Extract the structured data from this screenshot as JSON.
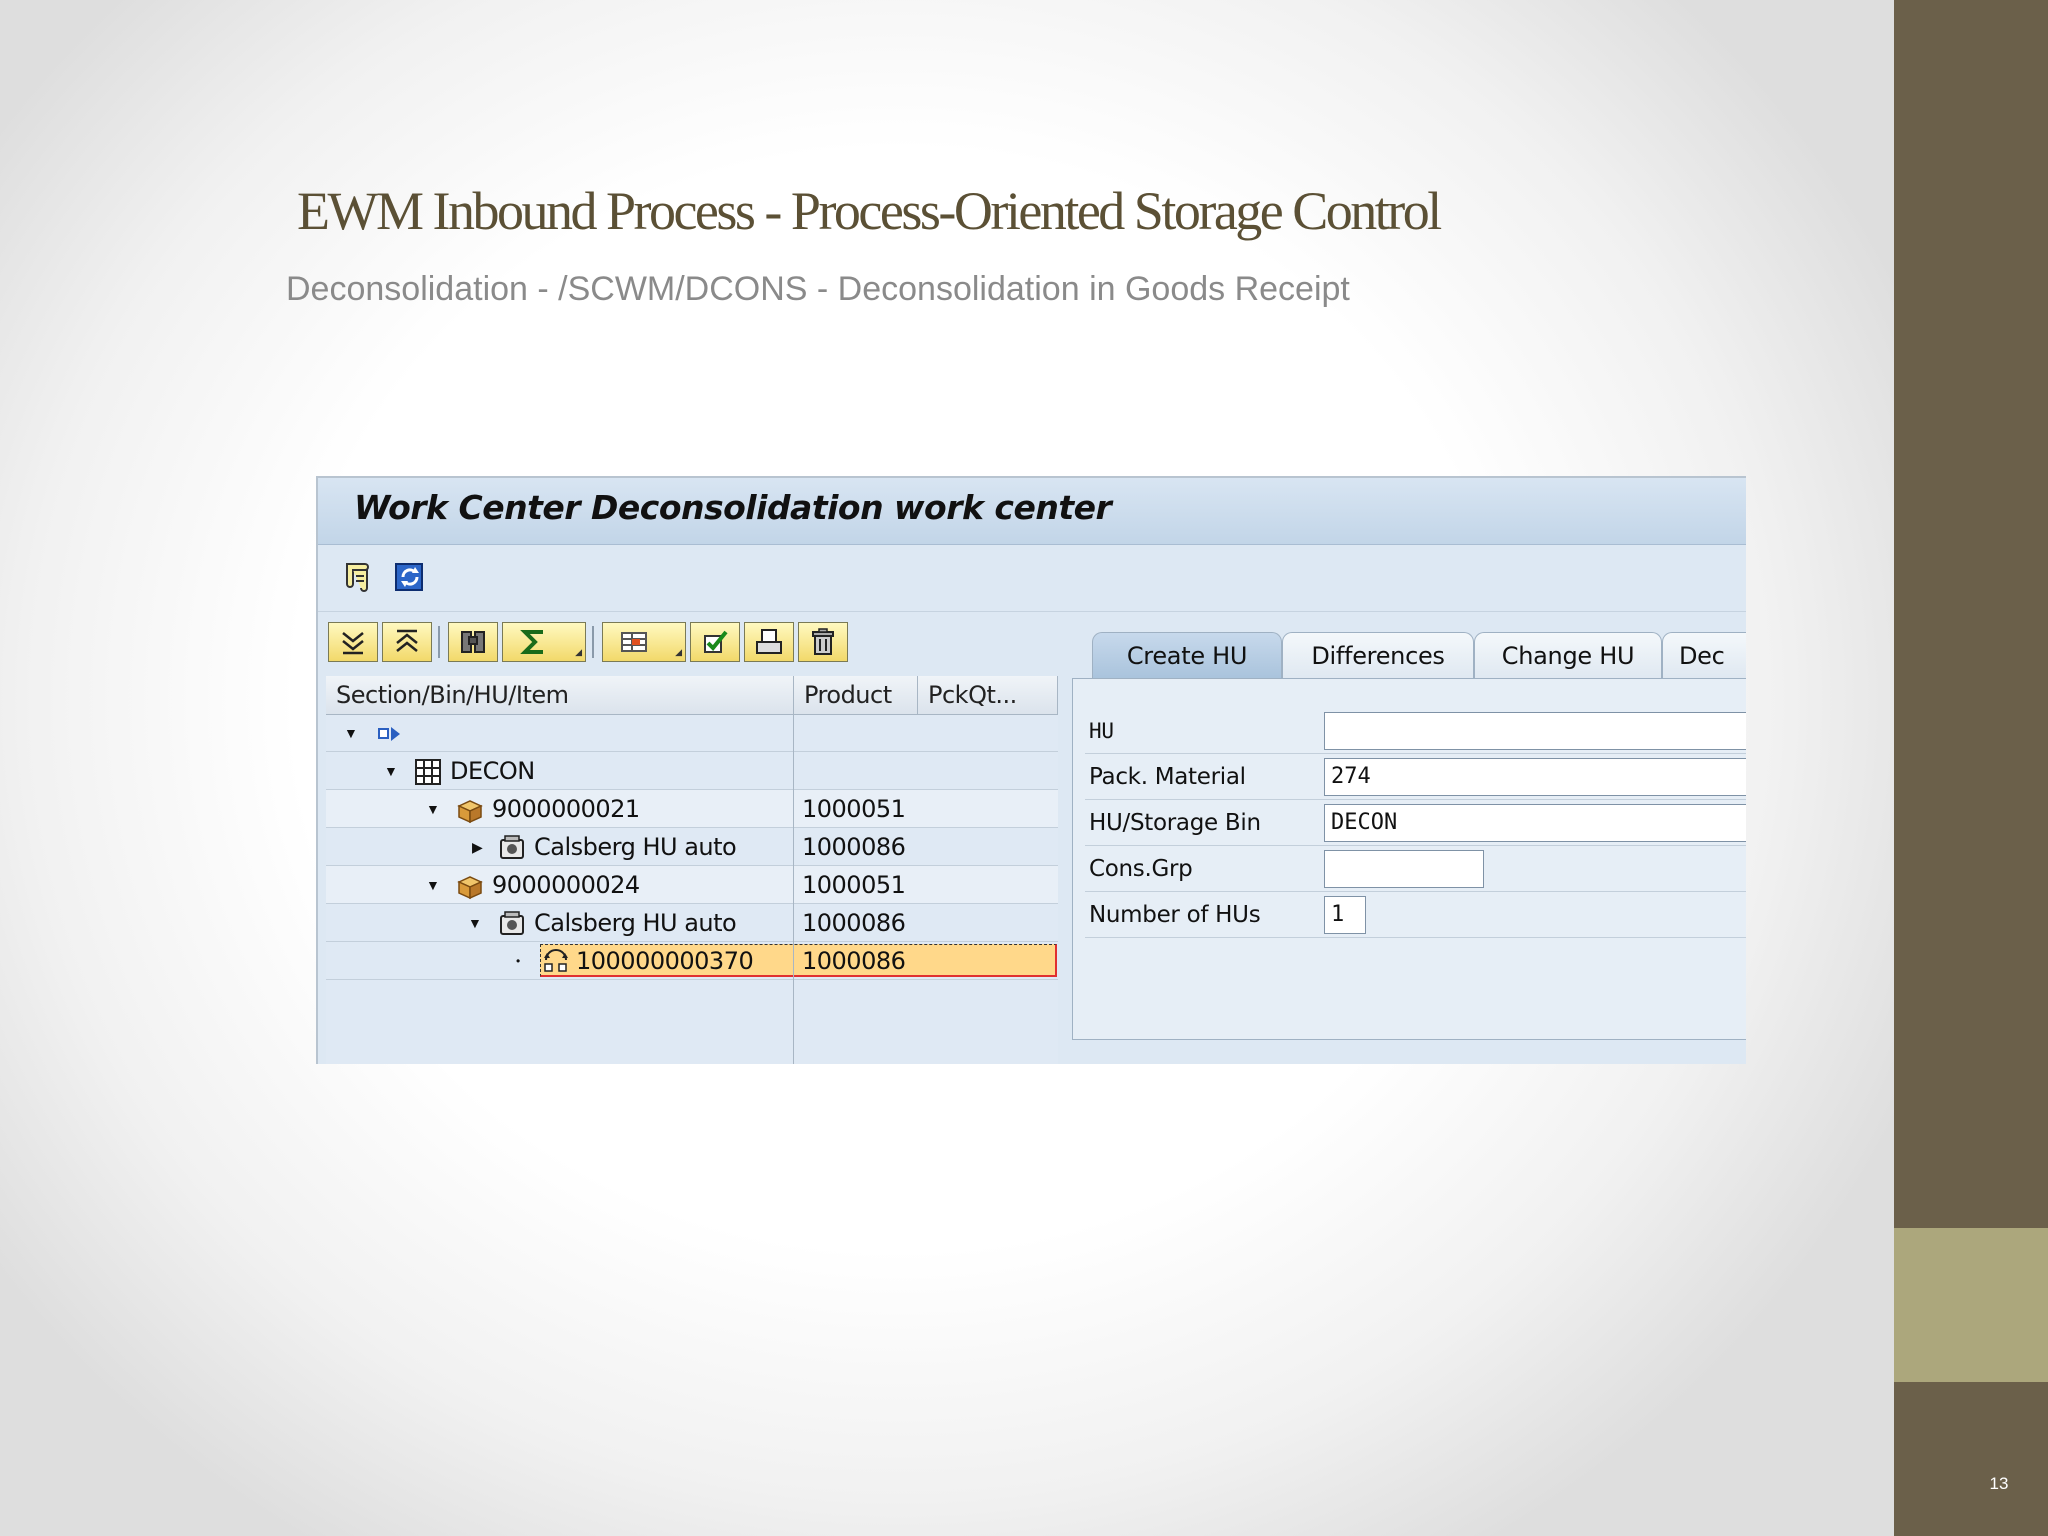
{
  "slide": {
    "title": "EWM Inbound Process - Process-Oriented Storage Control",
    "subtitle": "Deconsolidation -  /SCWM/DCONS - Deconsolidation in Goods Receipt",
    "page_number": "13"
  },
  "sap": {
    "window_title": "Work Center Deconsolidation work center",
    "app_toolbar": {
      "icons": [
        "log-icon",
        "refresh-icon"
      ]
    },
    "tree_toolbar": {
      "icons": [
        "expand-all-icon",
        "collapse-all-icon",
        "find-icon",
        "sum-icon",
        "layout-icon",
        "edit-check-icon",
        "print-icon",
        "delete-icon"
      ]
    },
    "tree": {
      "columns": [
        "Section/Bin/HU/Item",
        "Product",
        "PckQt..."
      ],
      "rows": [
        {
          "label": "",
          "product": "",
          "level": 0,
          "expand": "down",
          "icon": "section-arrow-icon"
        },
        {
          "label": "DECON",
          "product": "",
          "level": 1,
          "expand": "down",
          "icon": "storage-bin-icon"
        },
        {
          "label": "9000000021",
          "product": "1000051",
          "level": 2,
          "expand": "down",
          "icon": "box-icon"
        },
        {
          "label": "Calsberg HU auto",
          "product": "1000086",
          "level": 3,
          "expand": "right",
          "icon": "hu-item-icon"
        },
        {
          "label": "9000000024",
          "product": "1000051",
          "level": 2,
          "expand": "down",
          "icon": "box-icon"
        },
        {
          "label": "Calsberg HU auto",
          "product": "1000086",
          "level": 3,
          "expand": "down",
          "icon": "hu-item-icon"
        },
        {
          "label": "100000000370",
          "product": "1000086",
          "level": 4,
          "expand": "dot",
          "icon": "warehouse-task-icon",
          "selected": true
        }
      ]
    },
    "tabs": [
      "Create HU",
      "Differences",
      "Change HU",
      "Dec"
    ],
    "active_tab": "Create HU",
    "form": {
      "hu_label": "HU",
      "hu_value": "",
      "pack_material_label": "Pack. Material",
      "pack_material_value": "274",
      "hu_storage_bin_label": "HU/Storage Bin",
      "hu_storage_bin_value": "DECON",
      "cons_grp_label": "Cons.Grp",
      "cons_grp_value": "",
      "number_of_hus_label": "Number of HUs",
      "number_of_hus_value": "1"
    },
    "colors": {
      "selection": "#ffd88a",
      "panel": "#dde8f3",
      "band": "#6b604a",
      "band_accent": "#aca77c"
    }
  }
}
